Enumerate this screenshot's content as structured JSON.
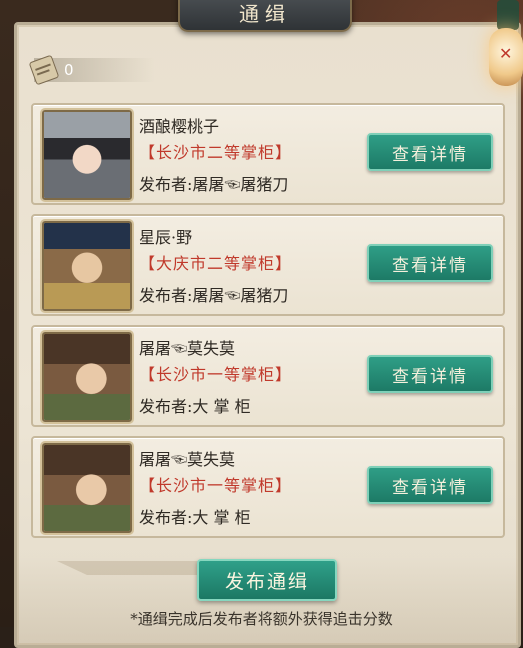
{
  "title": "通缉",
  "counter": {
    "icon": "scroll-icon",
    "value": "0"
  },
  "cards": [
    {
      "name": "酒酿樱桃子",
      "rank": "【长沙市二等掌柜】",
      "publisher": "发布者:屠屠☜屠猪刀",
      "button": "查看详情",
      "avatar_icon": "female-avatar-icon"
    },
    {
      "name": "星辰·野",
      "rank": "【大庆市二等掌柜】",
      "publisher": "发布者:屠屠☜屠猪刀",
      "button": "查看详情",
      "avatar_icon": "official-avatar-icon"
    },
    {
      "name": "屠屠☜莫失莫",
      "rank": "【长沙市一等掌柜】",
      "publisher": "发布者:大 掌 柜",
      "button": "查看详情",
      "avatar_icon": "male-avatar-icon"
    },
    {
      "name": "屠屠☜莫失莫",
      "rank": "【长沙市一等掌柜】",
      "publisher": "发布者:大 掌 柜",
      "button": "查看详情",
      "avatar_icon": "male-avatar-icon"
    }
  ],
  "publish_button": "发布通缉",
  "footnote": "*通缉完成后发布者将额外获得追击分数",
  "colors": {
    "button_green": "#1d7a66",
    "rank_red": "#c0392b",
    "panel_bg": "#ede5d5"
  }
}
